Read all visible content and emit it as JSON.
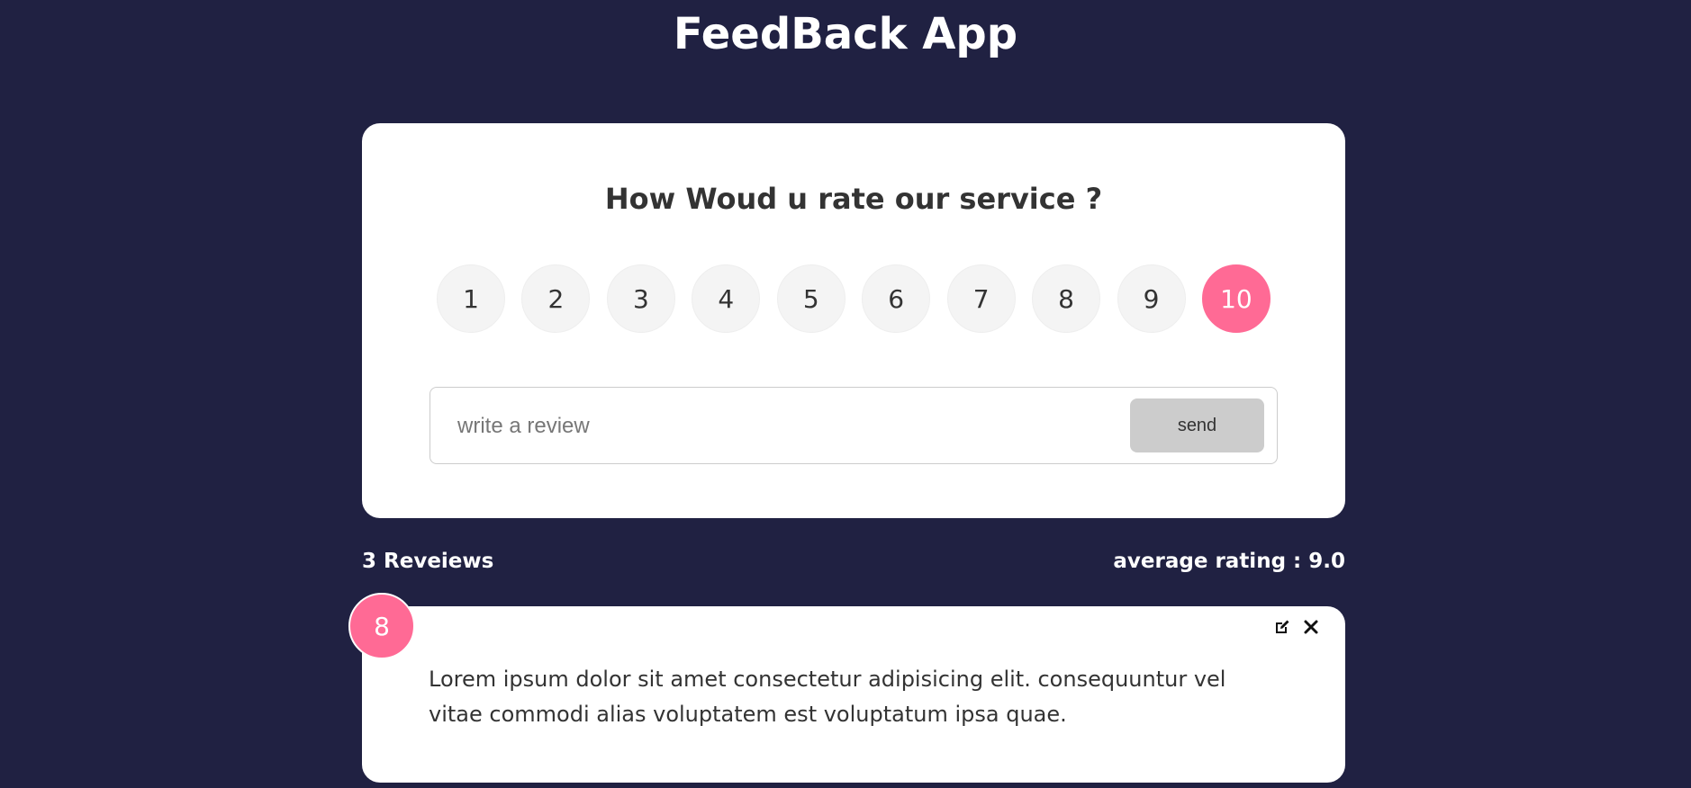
{
  "app": {
    "title": "FeedBack App"
  },
  "rating_card": {
    "question": "How Woud u rate our service ?",
    "options": [
      "1",
      "2",
      "3",
      "4",
      "5",
      "6",
      "7",
      "8",
      "9",
      "10"
    ],
    "selected": "10",
    "review_input": {
      "value": "",
      "placeholder": "write a review"
    },
    "send_label": "send"
  },
  "stats": {
    "reviews_count": "3 Reveiews",
    "average_rating": "average rating : 9.0"
  },
  "reviews": [
    {
      "rating": "8",
      "text": "Lorem ipsum dolor sit amet consectetur adipisicing elit. consequuntur vel vitae commodi alias voluptatem est voluptatum ipsa quae.",
      "edit_icon": "edit-icon",
      "delete_icon": "close-icon"
    }
  ],
  "colors": {
    "background": "#202142",
    "accent": "#ff6a95",
    "card": "#ffffff",
    "button_disabled": "#cccccc"
  }
}
